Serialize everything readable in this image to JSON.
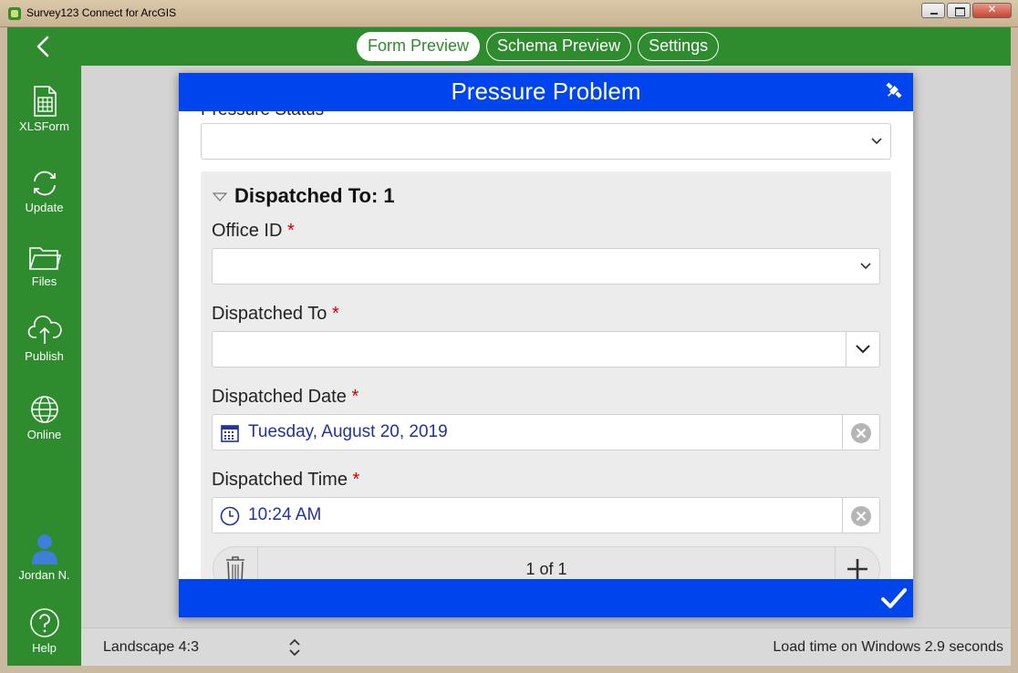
{
  "window": {
    "title": "Survey123 Connect for ArcGIS"
  },
  "topbar": {
    "tabs": [
      {
        "label": "Form Preview",
        "active": true
      },
      {
        "label": "Schema Preview",
        "active": false
      },
      {
        "label": "Settings",
        "active": false
      }
    ]
  },
  "sidebar": {
    "items": [
      {
        "label": "XLSForm",
        "icon": "spreadsheet-icon"
      },
      {
        "label": "Update",
        "icon": "refresh-icon"
      },
      {
        "label": "Files",
        "icon": "folder-icon"
      },
      {
        "label": "Publish",
        "icon": "cloud-upload-icon"
      },
      {
        "label": "Online",
        "icon": "globe-icon"
      }
    ],
    "user": {
      "label": "Jordan N.",
      "icon": "user-icon"
    },
    "help": {
      "label": "Help",
      "icon": "help-icon"
    }
  },
  "form": {
    "title": "Pressure Problem",
    "cut_label": "Pressure Status",
    "repeat_title": "Dispatched To: 1",
    "fields": [
      {
        "label": "Office ID",
        "required_mark": "*",
        "value": ""
      },
      {
        "label": "Dispatched To",
        "required_mark": "*",
        "value": ""
      },
      {
        "label": "Dispatched Date",
        "required_mark": "*",
        "value": "Tuesday, August 20, 2019"
      },
      {
        "label": "Dispatched Time",
        "required_mark": "*",
        "value": "10:24 AM"
      }
    ],
    "pager": "1 of 1"
  },
  "statusbar": {
    "orientation": "Landscape 4:3",
    "load_time": "Load time on Windows 2.9 seconds"
  },
  "colors": {
    "app_green": "#2e8b2e",
    "form_blue": "#0044ee",
    "required_red": "#cc0000",
    "value_blue": "#223399"
  }
}
